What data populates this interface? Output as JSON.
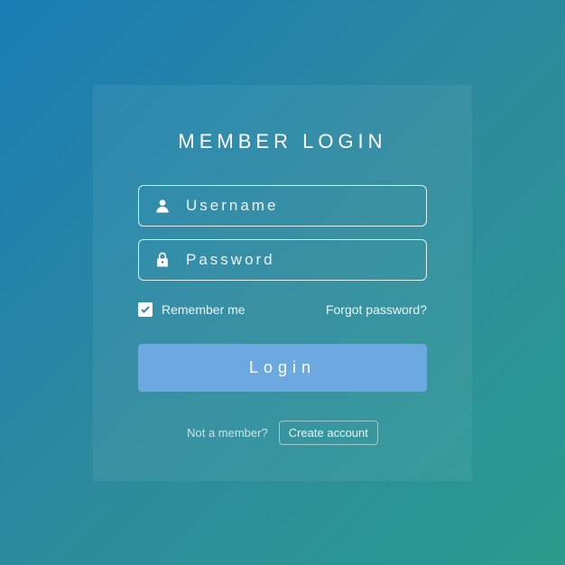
{
  "title": "MEMBER LOGIN",
  "username": {
    "placeholder": "Username"
  },
  "password": {
    "placeholder": "Password"
  },
  "remember": {
    "label": "Remember me",
    "checked": true
  },
  "forgot": "Forgot password?",
  "loginButton": "Login",
  "signup": {
    "prompt": "Not a member?",
    "action": "Create account"
  }
}
